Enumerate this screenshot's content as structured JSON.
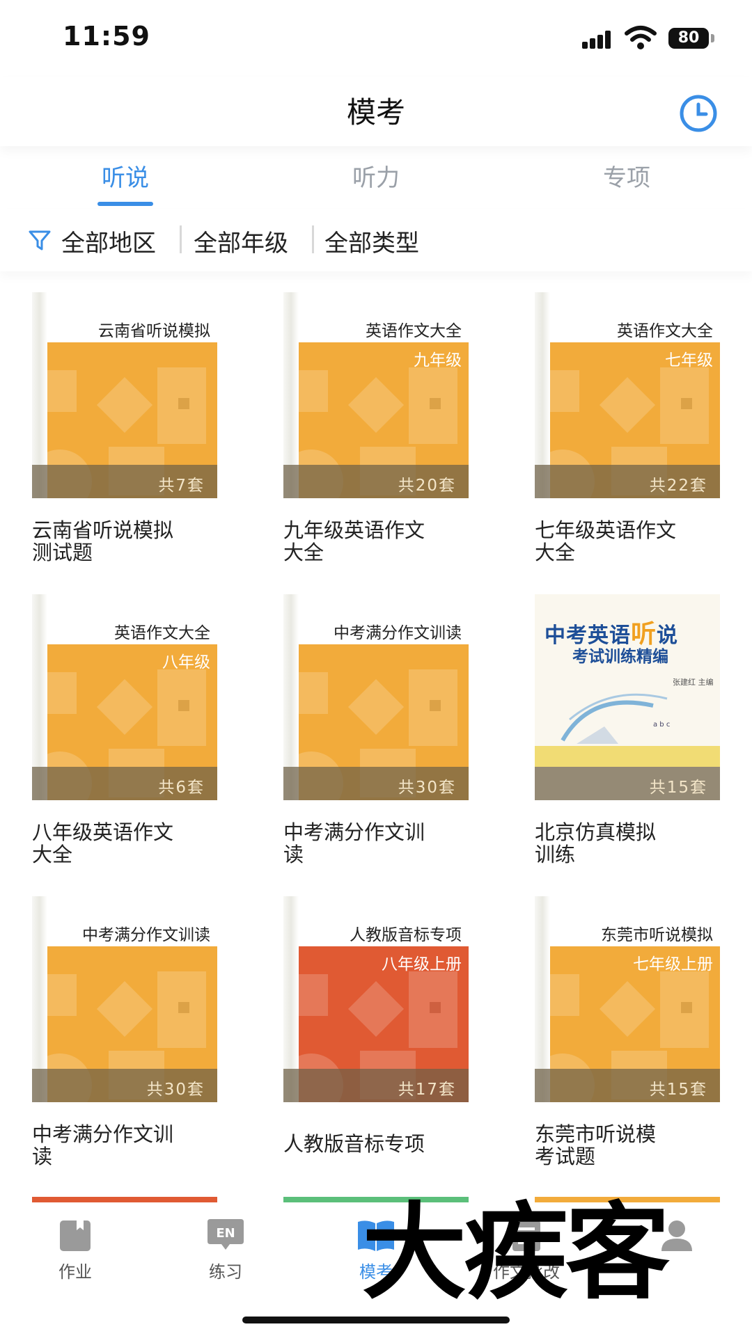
{
  "status": {
    "time": "11:59",
    "battery": "80"
  },
  "header": {
    "title": "模考"
  },
  "tabs": [
    {
      "label": "听说",
      "active": true
    },
    {
      "label": "听力",
      "active": false
    },
    {
      "label": "专项",
      "active": false
    }
  ],
  "filters": [
    "全部地区",
    "全部年级",
    "全部类型"
  ],
  "books": [
    {
      "cover_title": "云南省听说模拟",
      "cover_subtitle": "",
      "count": "共7套",
      "label": "云南省听说模拟\n测试题",
      "color": "#f2ab3b"
    },
    {
      "cover_title": "英语作文大全",
      "cover_subtitle": "九年级",
      "count": "共20套",
      "label": "九年级英语作文\n大全",
      "color": "#f2ab3b"
    },
    {
      "cover_title": "英语作文大全",
      "cover_subtitle": "七年级",
      "count": "共22套",
      "label": "七年级英语作文\n大全",
      "color": "#f2ab3b"
    },
    {
      "cover_title": "英语作文大全",
      "cover_subtitle": "八年级",
      "count": "共6套",
      "label": "八年级英语作文\n大全",
      "color": "#f2ab3b"
    },
    {
      "cover_title": "中考满分作文训读",
      "cover_subtitle": "",
      "count": "共30套",
      "label": "中考满分作文训\n读",
      "color": "#f2ab3b"
    },
    {
      "cover_title": "中考英语听说",
      "cover_subtitle": "考试训练精编",
      "count": "共15套",
      "label": "北京仿真模拟\n训练",
      "color": "#faf7ee",
      "photo": true,
      "photo_highlight": "听",
      "author": "张建红 主编"
    },
    {
      "cover_title": "中考满分作文训读",
      "cover_subtitle": "",
      "count": "共30套",
      "label": "中考满分作文训\n读",
      "color": "#f2ab3b"
    },
    {
      "cover_title": "人教版音标专项",
      "cover_subtitle": "八年级上册",
      "count": "共17套",
      "label": "人教版音标专项",
      "color": "#e05a33"
    },
    {
      "cover_title": "东莞市听说模拟",
      "cover_subtitle": "七年级上册",
      "count": "共15套",
      "label": "东莞市听说模\n考试题",
      "color": "#f2ab3b"
    }
  ],
  "peek_colors": [
    "#e05a33",
    "#5bbf7a",
    "#f2ab3b"
  ],
  "nav": [
    {
      "label": "作业",
      "icon": "homework-icon",
      "active": false
    },
    {
      "label": "练习",
      "icon": "practice-en-icon",
      "active": false
    },
    {
      "label": "模考",
      "icon": "mock-exam-book-icon",
      "active": true
    },
    {
      "label": "作文批改",
      "icon": "essay-correction-icon",
      "active": false
    },
    {
      "label": "",
      "icon": "profile-icon",
      "active": false
    }
  ],
  "watermark": "大疾客",
  "colors": {
    "accent": "#3a8ee6",
    "cover_orange": "#f2ab3b",
    "cover_red": "#e05a33"
  }
}
